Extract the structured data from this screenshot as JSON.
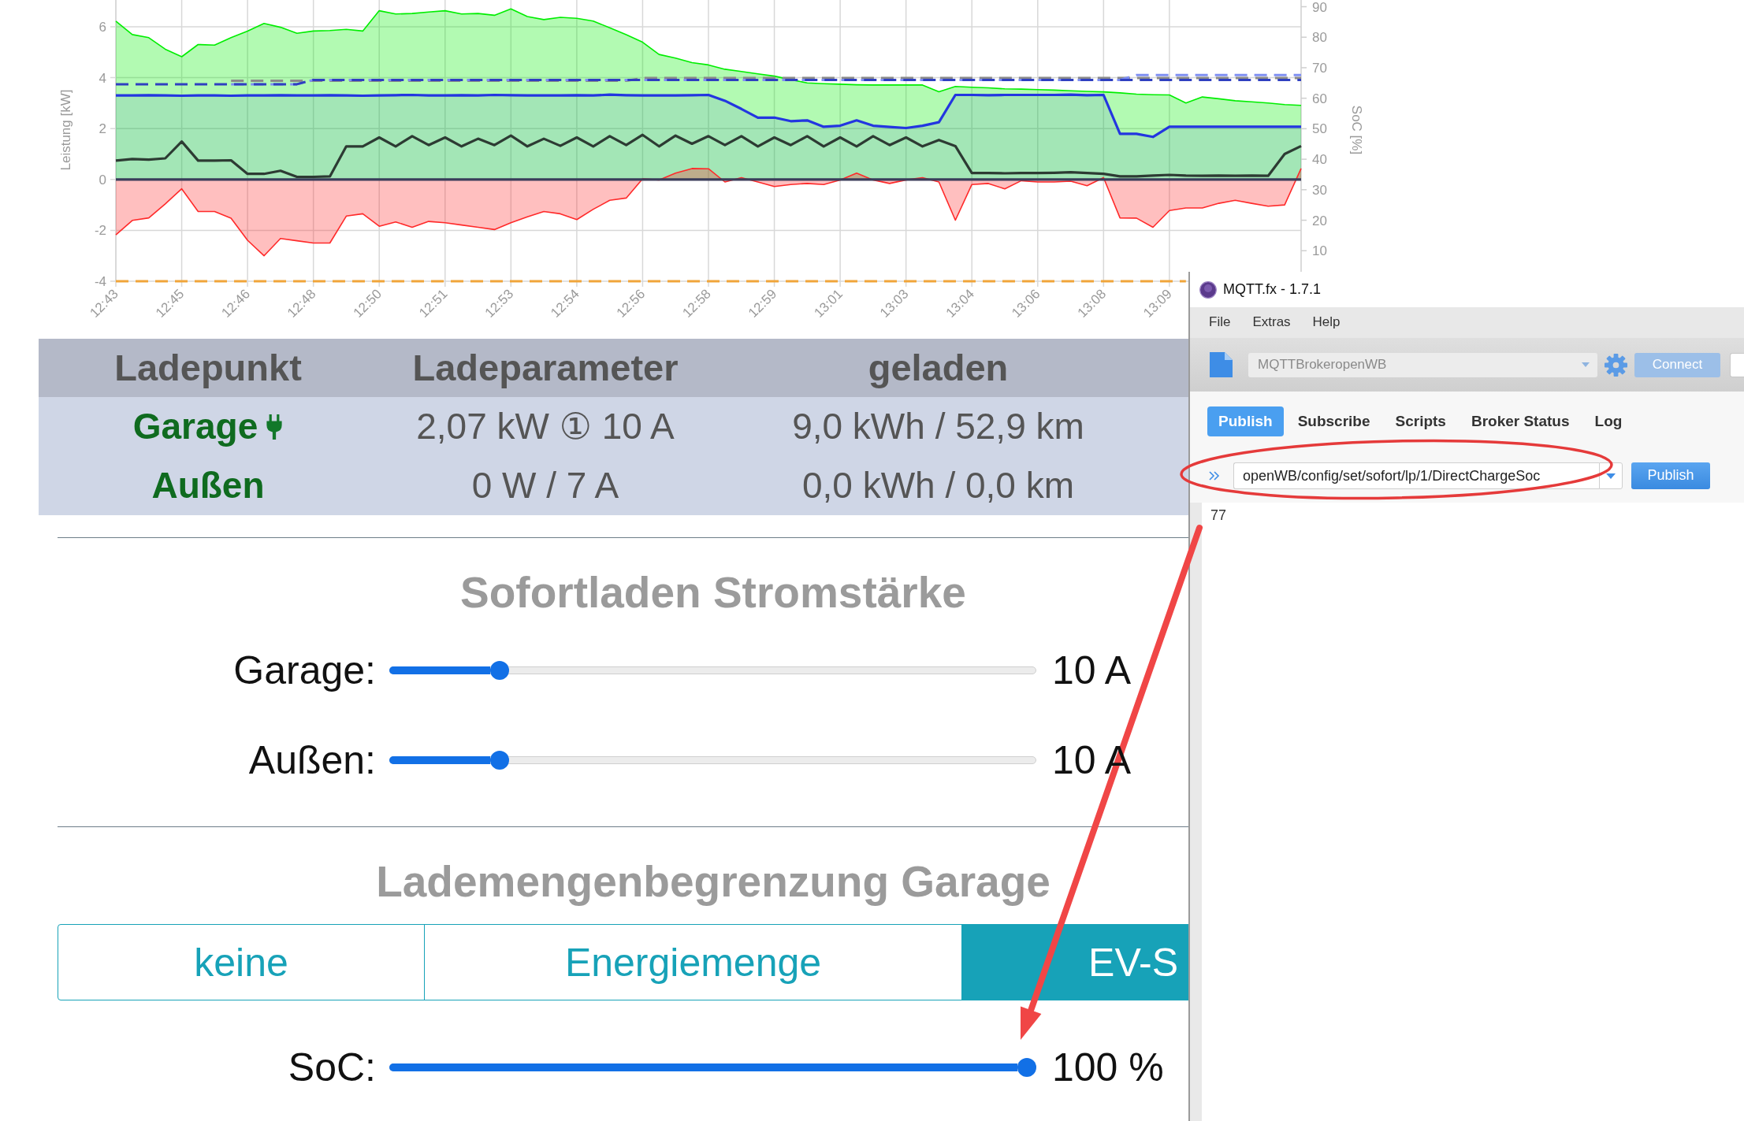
{
  "chart": {
    "chart_data": {
      "type": "area",
      "grid": true,
      "ylabel": "Leistung [kW]",
      "y2label": "SoC [%]",
      "categories": [
        "12:43",
        null,
        null,
        null,
        "12:45",
        null,
        null,
        null,
        "12:46",
        null,
        null,
        null,
        "12:48",
        null,
        null,
        null,
        "12:50",
        null,
        null,
        null,
        "12:51",
        null,
        null,
        null,
        "12:53",
        null,
        null,
        null,
        "12:54",
        null,
        null,
        null,
        "12:56",
        null,
        null,
        null,
        "12:58",
        null,
        null,
        null,
        "12:59",
        null,
        null,
        null,
        "13:01",
        null,
        null,
        null,
        "13:03",
        null,
        null,
        null,
        "13:04",
        null,
        null,
        null,
        "13:06",
        null,
        null,
        null,
        "13:08",
        null,
        null,
        null,
        "13:09",
        null,
        null,
        null,
        null,
        null,
        null,
        null,
        null
      ],
      "ylim": [
        -4,
        7.05
      ],
      "y2lim": [
        0,
        92.2
      ],
      "yticks": [
        -4,
        -2,
        0,
        2,
        4,
        6
      ],
      "y2ticks": [
        10,
        20,
        30,
        40,
        50,
        60,
        70,
        80,
        90
      ],
      "series": [
        {
          "color": "#00ee00",
          "values": [
            6.22,
            5.69,
            5.57,
            5.12,
            4.82,
            5.3,
            5.28,
            5.57,
            5.83,
            6.13,
            5.98,
            5.74,
            5.83,
            5.85,
            5.9,
            5.83,
            6.63,
            6.5,
            6.52,
            6.58,
            6.63,
            6.5,
            6.52,
            6.45,
            6.7,
            6.4,
            6.28,
            6.37,
            6.33,
            6.22,
            5.96,
            5.69,
            5.39,
            4.91,
            4.77,
            4.59,
            4.5,
            4.33,
            4.24,
            4.15,
            4.06,
            3.92,
            3.79,
            3.76,
            3.74,
            3.72,
            3.71,
            3.71,
            3.71,
            3.71,
            3.44,
            3.65,
            3.62,
            3.6,
            3.56,
            3.55,
            3.53,
            3.51,
            3.48,
            3.46,
            3.44,
            3.4,
            3.35,
            3.33,
            3.32,
            3.0,
            3.24,
            3.17,
            3.09,
            3.05,
            3.0,
            2.94,
            2.91
          ]
        },
        {
          "color": "#2336e0",
          "values": [
            3.3,
            3.3,
            3.31,
            3.3,
            3.29,
            3.3,
            3.3,
            3.29,
            3.3,
            3.3,
            3.31,
            3.3,
            3.3,
            3.31,
            3.3,
            3.29,
            3.3,
            3.31,
            3.32,
            3.3,
            3.3,
            3.31,
            3.3,
            3.32,
            3.31,
            3.3,
            3.3,
            3.3,
            3.31,
            3.3,
            3.33,
            3.31,
            3.3,
            3.3,
            3.3,
            3.31,
            3.32,
            3.09,
            2.77,
            2.43,
            2.43,
            2.29,
            2.32,
            2.07,
            2.11,
            2.32,
            2.11,
            2.06,
            2.02,
            2.11,
            2.25,
            3.32,
            3.32,
            3.31,
            3.32,
            3.32,
            3.32,
            3.32,
            3.33,
            3.31,
            3.32,
            1.79,
            1.79,
            1.67,
            2.07,
            2.07,
            2.07,
            2.07,
            2.07,
            2.07,
            2.07,
            2.07,
            2.07
          ]
        },
        {
          "color": "#ff2a2a",
          "values": [
            -2.18,
            -1.61,
            -1.51,
            -0.96,
            -0.37,
            -1.26,
            -1.26,
            -1.52,
            -2.39,
            -3.0,
            -2.32,
            -2.41,
            -2.5,
            -2.5,
            -1.44,
            -1.35,
            -1.84,
            -1.67,
            -1.88,
            -1.65,
            -1.7,
            -1.79,
            -1.88,
            -1.97,
            -1.7,
            -1.47,
            -1.26,
            -1.35,
            -1.58,
            -1.17,
            -0.82,
            -0.73,
            0.02,
            -0.02,
            0.25,
            0.43,
            0.42,
            -0.1,
            0.07,
            -0.1,
            -0.28,
            -0.2,
            -0.16,
            -0.2,
            -0.02,
            0.25,
            -0.02,
            -0.16,
            -0.02,
            0.07,
            -0.1,
            -1.6,
            -0.2,
            -0.16,
            -0.37,
            -0.05,
            -0.1,
            -0.1,
            -0.07,
            -0.25,
            0.07,
            -1.51,
            -1.52,
            -1.88,
            -1.22,
            -1.12,
            -1.12,
            -0.94,
            -0.82,
            -0.94,
            -1.05,
            -1.0,
            0.43
          ]
        },
        {
          "type": "line",
          "color": "#3a3d5a",
          "values": [
            0,
            0,
            0,
            0,
            0,
            0,
            0,
            0,
            0,
            0,
            0,
            0,
            0,
            0,
            0,
            0,
            0,
            0,
            0,
            0,
            0,
            0,
            0,
            0,
            0,
            0,
            0,
            0,
            0,
            0,
            0,
            0,
            0,
            0,
            0,
            0,
            0,
            0,
            0,
            0,
            0,
            0,
            0,
            0,
            0,
            0,
            0,
            0,
            0,
            0,
            0,
            0,
            0,
            0,
            0,
            0,
            0,
            0,
            0,
            0,
            0,
            0,
            0,
            0,
            0,
            0,
            0,
            0,
            0,
            0,
            0,
            0,
            0
          ]
        },
        {
          "type": "line",
          "color": "#2d3b33",
          "values": [
            0.74,
            0.8,
            0.78,
            0.83,
            1.49,
            0.74,
            0.74,
            0.75,
            0.22,
            0.22,
            0.34,
            0.1,
            0.1,
            0.12,
            1.3,
            1.3,
            1.65,
            1.3,
            1.7,
            1.35,
            1.65,
            1.3,
            1.6,
            1.35,
            1.72,
            1.3,
            1.6,
            1.32,
            1.65,
            1.3,
            1.7,
            1.35,
            1.75,
            1.3,
            1.72,
            1.4,
            1.7,
            1.35,
            1.7,
            1.3,
            1.65,
            1.35,
            1.7,
            1.3,
            1.65,
            1.3,
            1.7,
            1.35,
            1.65,
            1.3,
            1.55,
            1.31,
            0.25,
            0.25,
            0.24,
            0.25,
            0.25,
            0.26,
            0.28,
            0.25,
            0.22,
            0.12,
            0.12,
            0.15,
            0.18,
            0.15,
            0.14,
            0.15,
            0.14,
            0.15,
            0.14,
            1.0,
            1.31
          ]
        },
        {
          "type": "line",
          "axis": "y2",
          "line_style": "dashed",
          "color": "#8a8a8a",
          "values": [
            null,
            null,
            null,
            null,
            null,
            null,
            null,
            65.7,
            65.7,
            65.7,
            65.7,
            65.7,
            65.7,
            65.7,
            65.7,
            65.7,
            65.7,
            65.7,
            65.7,
            65.7,
            65.7,
            65.7,
            65.7,
            65.7,
            65.7,
            65.7,
            65.7,
            65.7,
            65.7,
            65.7,
            65.7,
            65.7,
            66.6,
            66.6,
            66.6,
            66.6,
            66.6,
            66.6,
            66.6,
            66.6,
            66.6,
            66.6,
            66.6,
            66.6,
            66.6,
            66.6,
            66.6,
            66.6,
            66.6,
            66.6,
            66.6,
            66.6,
            66.6,
            66.6,
            66.6,
            66.6,
            66.6,
            66.6,
            66.6,
            66.6,
            66.6,
            66.6,
            66.6,
            66.6,
            66.6,
            66.6,
            66.6,
            66.6,
            66.6,
            66.6,
            66.6,
            66.6,
            66.6
          ]
        },
        {
          "type": "line",
          "axis": "y2",
          "line_style": "dashed",
          "color": "#7f8ff2",
          "values": [
            null,
            null,
            null,
            null,
            null,
            null,
            null,
            64.6,
            64.6,
            64.6,
            64.6,
            64.6,
            66.0,
            66.0,
            66.0,
            66.0,
            66.0,
            66.0,
            66.0,
            66.0,
            66.0,
            66.0,
            66.0,
            66.0,
            66.0,
            66.0,
            66.0,
            66.0,
            66.0,
            66.0,
            66.0,
            66.0,
            66.0,
            66.0,
            66.0,
            66.0,
            66.0,
            66.0,
            66.0,
            66.0,
            66.0,
            66.0,
            66.0,
            66.0,
            66.0,
            66.0,
            66.0,
            66.0,
            66.0,
            66.0,
            66.0,
            66.0,
            66.0,
            66.0,
            66.0,
            66.0,
            66.0,
            66.0,
            66.0,
            66.0,
            66.0,
            66.0,
            67.6,
            67.6,
            67.6,
            67.6,
            67.6,
            67.6,
            67.6,
            67.6,
            67.6,
            67.6,
            67.6
          ]
        },
        {
          "type": "line",
          "axis": "y2",
          "line_style": "dashed",
          "color": "#2f3fc0",
          "values": [
            64.6,
            64.6,
            64.6,
            64.6,
            64.6,
            64.6,
            64.6,
            64.6,
            64.6,
            64.6,
            64.6,
            64.6,
            66.0,
            66.0,
            66.0,
            66.0,
            66.0,
            66.0,
            66.0,
            66.0,
            66.0,
            66.0,
            66.0,
            66.0,
            66.0,
            66.0,
            66.0,
            66.0,
            66.0,
            66.0,
            66.0,
            66.0,
            66.0,
            66.0,
            66.0,
            66.0,
            66.0,
            66.0,
            66.0,
            66.0,
            66.0,
            66.0,
            66.0,
            66.0,
            66.0,
            66.0,
            66.0,
            66.0,
            66.0,
            66.0,
            66.0,
            66.0,
            66.0,
            66.0,
            66.0,
            66.0,
            66.0,
            66.0,
            66.0,
            66.0,
            66.0,
            66.0,
            66.0,
            66.0,
            66.0,
            66.0,
            66.0,
            66.0,
            66.0,
            66.0,
            66.0,
            66.0,
            66.0
          ]
        },
        {
          "type": "line",
          "axis": "y2",
          "line_style": "dashed",
          "color": "#f0a53a",
          "values": [
            0,
            0,
            0,
            0,
            0,
            0,
            0,
            0,
            0,
            0,
            0,
            0,
            0,
            0,
            0,
            0,
            0,
            0,
            0,
            0,
            0,
            0,
            0,
            0,
            0,
            0,
            0,
            0,
            0,
            0,
            0,
            0,
            0,
            0,
            0,
            0,
            0,
            0,
            0,
            0,
            0,
            0,
            0,
            0,
            0,
            0,
            0,
            0,
            0,
            0,
            0,
            0,
            0,
            0,
            0,
            0,
            0,
            0,
            0,
            0,
            0,
            0,
            0,
            0,
            0,
            0,
            null,
            null,
            null,
            null,
            null,
            null,
            null
          ]
        }
      ]
    }
  },
  "table": {
    "columns": [
      "Ladepunkt",
      "Ladeparameter",
      "geladen"
    ],
    "rows": [
      {
        "name": "Garage",
        "plugged": true,
        "parameter": "2,07 kW ① 10 A",
        "charged": "9,0 kWh / 52,9 km"
      },
      {
        "name": "Außen",
        "plugged": false,
        "parameter": "0 W / 7 A",
        "charged": "0,0 kWh / 0,0 km"
      }
    ]
  },
  "current_section": {
    "title": "Sofortladen Stromstärke",
    "sliders": [
      {
        "label": "Garage:",
        "level": 0.16,
        "reading": "10 A"
      },
      {
        "label": "Außen:",
        "level": 0.16,
        "reading": "10 A"
      }
    ]
  },
  "limit_section": {
    "title": "Lademengenbegrenzung Garage",
    "tabs": [
      {
        "label": "keine",
        "selected": false
      },
      {
        "label": "Energiemenge",
        "selected": false
      },
      {
        "label": "EV-S",
        "selected": true
      }
    ],
    "sliders": [
      {
        "label": "SoC:",
        "level": 1,
        "reading": "100 %"
      }
    ]
  },
  "mqtt_window": {
    "title": "MQTT.fx - 1.7.1",
    "menu": [
      "File",
      "Extras",
      "Help"
    ],
    "broker": {
      "value": "MQTTBrokeropenWB",
      "disabled": true
    },
    "connect_button": {
      "label": "Connect",
      "disabled": true
    },
    "tabs": [
      {
        "label": "Publish",
        "selected": true
      },
      {
        "label": "Subscribe",
        "selected": false
      },
      {
        "label": "Scripts",
        "selected": false
      },
      {
        "label": "Broker Status",
        "selected": false
      },
      {
        "label": "Log",
        "selected": false
      }
    ],
    "topic": "openWB/config/set/sofort/lp/1/DirectChargeSoc",
    "publish_button": "Publish",
    "payload": "77"
  },
  "annotations": [
    {
      "kind": "ellipse"
    },
    {
      "kind": "arrow"
    }
  ]
}
